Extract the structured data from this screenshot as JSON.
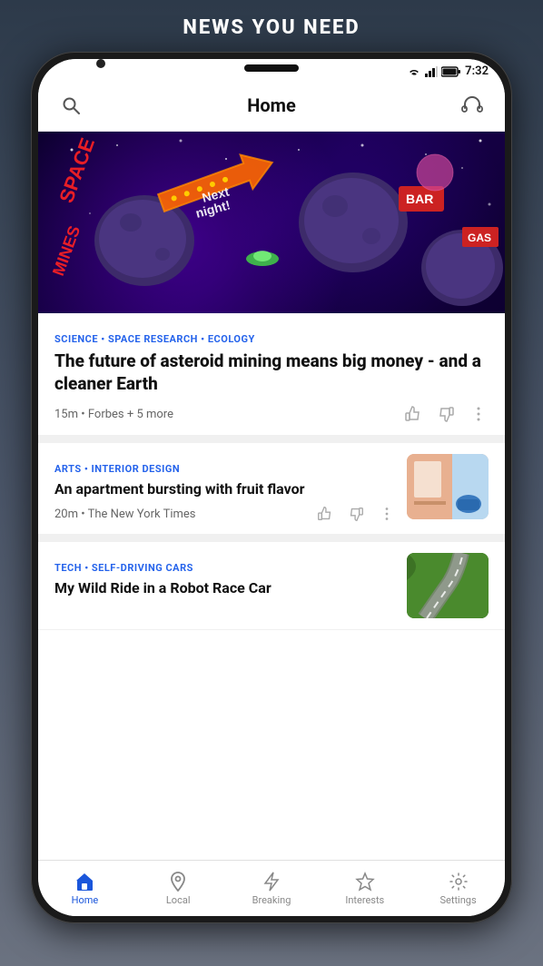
{
  "header": {
    "title": "NEWS YOU NEED"
  },
  "status_bar": {
    "time": "7:32"
  },
  "top_bar": {
    "title": "Home",
    "search_label": "search",
    "headphones_label": "headphones"
  },
  "hero": {
    "alt": "Space Mines illustration with neon sign"
  },
  "articles": [
    {
      "category": "SCIENCE • SPACE RESEARCH • ECOLOGY",
      "title": "The future of asteroid mining means big money - and a cleaner Earth",
      "meta": "15m • Forbes + 5 more",
      "has_image": false
    },
    {
      "category": "ARTS • INTERIOR DESIGN",
      "title": "An apartment bursting with fruit flavor",
      "meta": "20m • The New York Times",
      "has_image": true,
      "image_type": "apt"
    },
    {
      "category": "TECH • SELF-DRIVING CARS",
      "title": "My Wild Ride in a Robot Race Car",
      "meta": "",
      "has_image": true,
      "image_type": "car"
    }
  ],
  "nav": {
    "items": [
      {
        "label": "Home",
        "icon": "home-icon",
        "active": true
      },
      {
        "label": "Local",
        "icon": "location-icon",
        "active": false
      },
      {
        "label": "Breaking",
        "icon": "breaking-icon",
        "active": false
      },
      {
        "label": "Interests",
        "icon": "star-icon",
        "active": false
      },
      {
        "label": "Settings",
        "icon": "settings-icon",
        "active": false
      }
    ]
  },
  "colors": {
    "accent": "#1a56db",
    "text_primary": "#111111",
    "text_secondary": "#666666",
    "category_color": "#2563eb"
  }
}
